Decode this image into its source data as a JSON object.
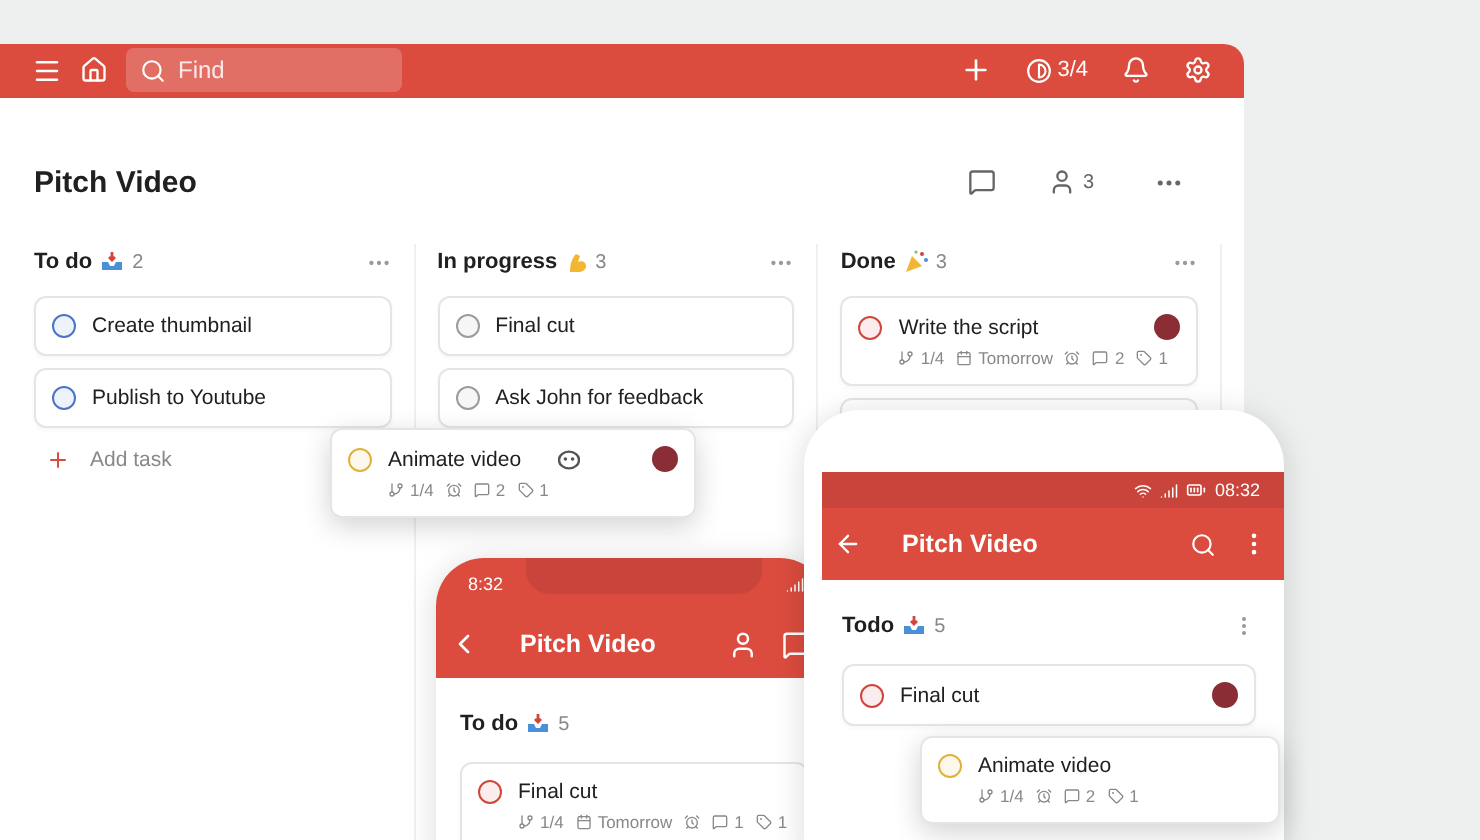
{
  "desktop": {
    "search": {
      "placeholder": "Find"
    },
    "karma": "3/4",
    "project": {
      "title": "Pitch Video",
      "members": "3"
    },
    "columns": [
      {
        "title": "To do",
        "emoji": {
          "kind": "inbox"
        },
        "count": "2",
        "tasks": [
          {
            "name": "Create thumbnail",
            "color": "#4a74c9"
          },
          {
            "name": "Publish to Youtube",
            "color": "#4a74c9"
          }
        ],
        "add_task": "Add task"
      },
      {
        "title": "In progress",
        "emoji": {
          "kind": "muscle"
        },
        "count": "3",
        "tasks": [
          {
            "name": "Final cut",
            "color": "#9b9b9b"
          },
          {
            "name": "Ask John for feedback",
            "color": "#9b9b9b"
          }
        ]
      },
      {
        "title": "Done",
        "emoji": {
          "kind": "party"
        },
        "count": "3",
        "tasks": [
          {
            "name": "Write the script",
            "color": "#d1453b",
            "avatar": true,
            "meta": [
              {
                "kind": "subtasks",
                "text": "1/4"
              },
              {
                "kind": "date",
                "text": "Tomorrow"
              },
              {
                "kind": "reminder"
              },
              {
                "kind": "comments",
                "text": "2"
              },
              {
                "kind": "labels",
                "text": "1"
              }
            ]
          }
        ],
        "more_cards": true
      }
    ],
    "dragged_task": {
      "name": "Animate video",
      "color": "#e0b23a",
      "avatar": true,
      "emoji": true,
      "meta": [
        {
          "kind": "subtasks",
          "text": "1/4"
        },
        {
          "kind": "reminder"
        },
        {
          "kind": "comments",
          "text": "2"
        },
        {
          "kind": "labels",
          "text": "1"
        }
      ]
    }
  },
  "phone_left": {
    "time": "8:32",
    "title": "Pitch Video",
    "section": {
      "title": "To do",
      "emoji": {
        "kind": "inbox"
      },
      "count": "5"
    },
    "task": {
      "name": "Final cut",
      "color": "#d1453b",
      "meta": [
        {
          "kind": "subtasks",
          "text": "1/4"
        },
        {
          "kind": "date",
          "text": "Tomorrow"
        },
        {
          "kind": "reminder"
        },
        {
          "kind": "comments",
          "text": "1"
        },
        {
          "kind": "labels",
          "text": "1"
        }
      ]
    }
  },
  "phone_right": {
    "time": "08:32",
    "title": "Pitch Video",
    "section": {
      "title": "Todo",
      "emoji": {
        "kind": "inbox"
      },
      "count": "5"
    },
    "task": {
      "name": "Final cut",
      "color": "#d1453b",
      "avatar": true
    },
    "dragged_task": {
      "name": "Animate video",
      "color": "#e0b23a",
      "meta": [
        {
          "kind": "subtasks",
          "text": "1/4"
        },
        {
          "kind": "reminder"
        },
        {
          "kind": "comments",
          "text": "2"
        },
        {
          "kind": "labels",
          "text": "1"
        }
      ]
    }
  }
}
